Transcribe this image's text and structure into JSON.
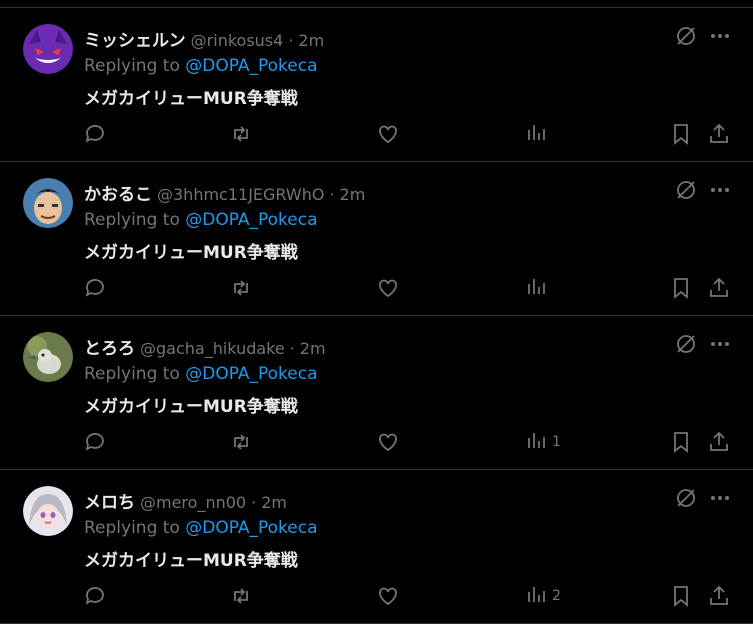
{
  "reply_prefix": "Replying to ",
  "posts": [
    {
      "name": "ミッシェルン",
      "handle": "@rinkosus4",
      "time": "2m",
      "mention": "@DOPA_Pokeca",
      "text": "メガカイリューMUR争奪戦",
      "views": ""
    },
    {
      "name": "かおるこ",
      "handle": "@3hhmc11JEGRWhO",
      "time": "2m",
      "mention": "@DOPA_Pokeca",
      "text": "メガカイリューMUR争奪戦",
      "views": ""
    },
    {
      "name": "とろろ",
      "handle": "@gacha_hikudake",
      "time": "2m",
      "mention": "@DOPA_Pokeca",
      "text": "メガカイリューMUR争奪戦",
      "views": "1"
    },
    {
      "name": "メロち",
      "handle": "@mero_nn00",
      "time": "2m",
      "mention": "@DOPA_Pokeca",
      "text": "メガカイリューMUR争奪戦",
      "views": "2"
    }
  ],
  "separator": "·",
  "colors": {
    "accent": "#1d9bf0",
    "muted": "#71767b",
    "text": "#e7e9ea",
    "border": "#2f3336"
  },
  "icons": [
    "reply-icon",
    "retweet-icon",
    "like-icon",
    "views-icon",
    "bookmark-icon",
    "share-icon",
    "grok-icon",
    "more-icon"
  ]
}
